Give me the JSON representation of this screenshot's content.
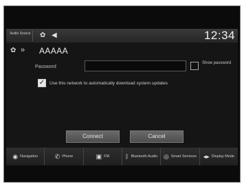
{
  "status_bar": {
    "audio_source_label": "Audio Source",
    "clock": "12:34",
    "icons": [
      "settings-gear-icon",
      "speaker-icon"
    ]
  },
  "header": {
    "icons": [
      "gear-icon",
      "wifi-signal-icon"
    ],
    "network_name": "AAAAA"
  },
  "form": {
    "password_label": "Password",
    "password_value": "",
    "show_password_label": "Show password",
    "show_password_checked": false,
    "auto_update_label": "Use this network to automatically download system updates",
    "auto_update_checked": true
  },
  "buttons": {
    "connect": "Connect",
    "cancel": "Cancel"
  },
  "nav": [
    {
      "label": "Navigation",
      "icon": "navigation-icon"
    },
    {
      "label": "Phone",
      "icon": "phone-icon"
    },
    {
      "label": "FM",
      "icon": "radio-icon"
    },
    {
      "label": "Bluetooth Audio",
      "icon": "bluetooth-icon"
    },
    {
      "label": "Smart Services",
      "icon": "smart-services-icon"
    },
    {
      "label": "Display Mode",
      "icon": "display-mode-icon"
    }
  ],
  "colors": {
    "screen_bg": "#151515",
    "bar_bg": "#262626",
    "button_bg": "#5c5c5c",
    "text": "#e6e6e6"
  }
}
